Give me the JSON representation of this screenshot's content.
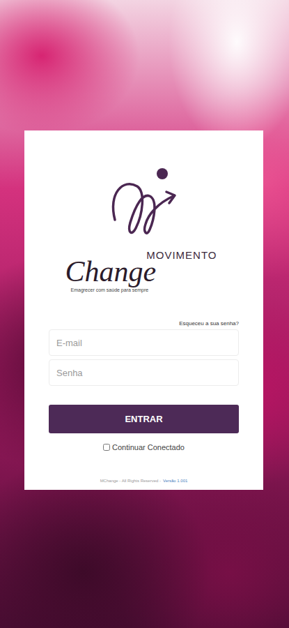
{
  "logo": {
    "brand_top": "MOVIMENTO",
    "brand_script": "Change",
    "tagline": "Emagrecer com saúde para sempre"
  },
  "forgot_password": "Esqueceu a sua senha?",
  "fields": [
    {
      "placeholder": "E-mail"
    },
    {
      "placeholder": "Senha"
    }
  ],
  "submit": "ENTRAR",
  "remember": {
    "label": "Continuar Conectado",
    "checked": false
  },
  "footer": {
    "text": "MChange - All Rights Reserved -",
    "version": "Versão 1.001"
  }
}
